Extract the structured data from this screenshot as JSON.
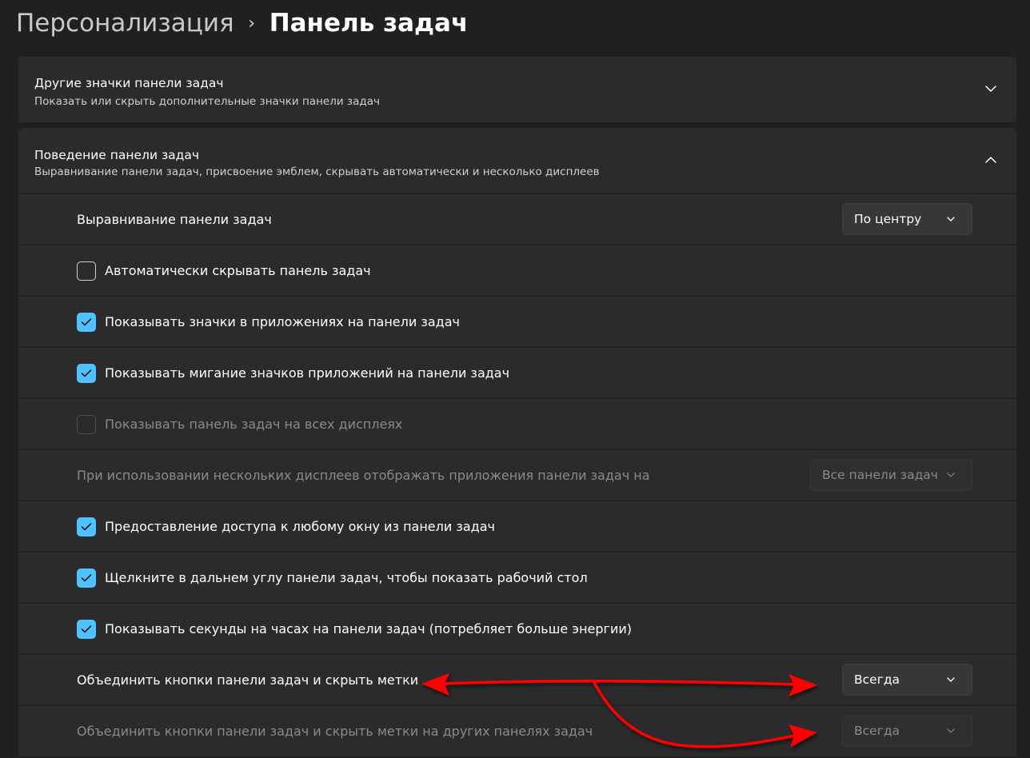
{
  "breadcrumb": {
    "parent": "Персонализация",
    "separator": "›",
    "current": "Панель задач"
  },
  "sections": {
    "other_icons": {
      "title": "Другие значки панели задач",
      "subtitle": "Показать или скрыть дополнительные значки панели задач",
      "icon": "chevron-down-icon"
    },
    "behavior": {
      "title": "Поведение панели задач",
      "subtitle": "Выравнивание панели задач, присвоение эмблем, скрывать автоматически и несколько дисплеев",
      "icon": "chevron-up-icon"
    }
  },
  "settings": {
    "alignment": {
      "label": "Выравнивание панели задач",
      "value": "По центру"
    },
    "auto_hide": {
      "label": "Автоматически скрывать панель задач",
      "checked": false
    },
    "badges": {
      "label": "Показывать значки в приложениях на панели задач",
      "checked": true
    },
    "flashing": {
      "label": "Показывать мигание значков приложений на панели задач",
      "checked": true
    },
    "all_displays": {
      "label": "Показывать панель задач на всех дисплеях",
      "checked": false,
      "disabled": true
    },
    "multi_display_apps": {
      "label": "При использовании нескольких дисплеев отображать приложения панели задач на",
      "value": "Все панели задач",
      "disabled": true
    },
    "share_window": {
      "label": "Предоставление доступа к любому окну из панели задач",
      "checked": true
    },
    "far_corner": {
      "label": "Щелкните в дальнем углу панели задач, чтобы показать рабочий стол",
      "checked": true
    },
    "seconds": {
      "label": "Показывать секунды на часах на панели задач (потребляет больше энергии)",
      "checked": true
    },
    "combine": {
      "label": "Объединить кнопки панели задач и скрыть метки",
      "value": "Всегда"
    },
    "combine_other": {
      "label": "Объединить кнопки панели задач и скрыть метки на других панелях задач",
      "value": "Всегда",
      "disabled": true
    }
  },
  "colors": {
    "background": "#202020",
    "card": "#2b2b2b",
    "accent": "#4cc2ff",
    "annotation_arrow": "#ff0000"
  }
}
